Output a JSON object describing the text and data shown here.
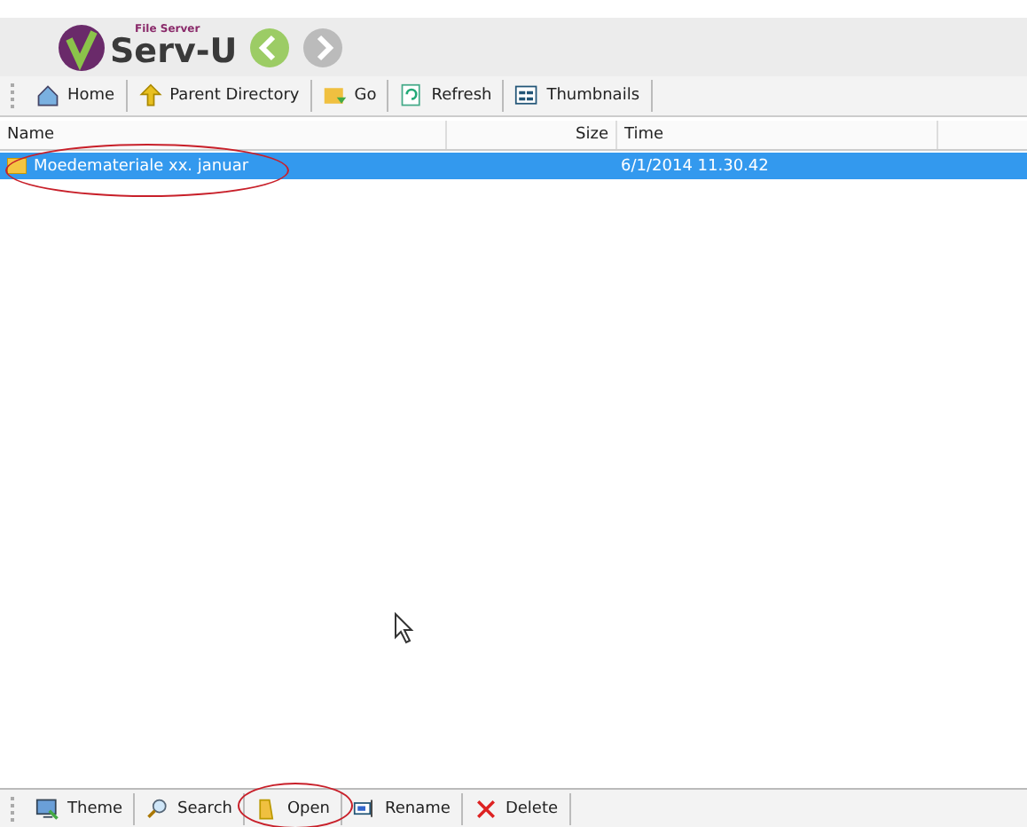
{
  "logo": {
    "caption": "File Server",
    "name": "Serv-U"
  },
  "toolbar": [
    {
      "kind": "home",
      "label": "Home"
    },
    {
      "kind": "parent",
      "label": "Parent Directory"
    },
    {
      "kind": "go",
      "label": "Go"
    },
    {
      "kind": "refresh",
      "label": "Refresh"
    },
    {
      "kind": "thumbs",
      "label": "Thumbnails"
    }
  ],
  "table": {
    "columns": [
      "Name",
      "Size",
      "Time"
    ],
    "rows": [
      {
        "name": "Moedemateriale xx. januar",
        "size": "",
        "time": "6/1/2014 11.30.42",
        "selected": true,
        "circled": true
      }
    ]
  },
  "bottom_toolbar": [
    {
      "kind": "theme",
      "label": "Theme",
      "circled": false
    },
    {
      "kind": "search",
      "label": "Search",
      "circled": false
    },
    {
      "kind": "open",
      "label": "Open",
      "circled": true
    },
    {
      "kind": "rename",
      "label": "Rename",
      "circled": false
    },
    {
      "kind": "delete",
      "label": "Delete",
      "circled": false
    }
  ]
}
